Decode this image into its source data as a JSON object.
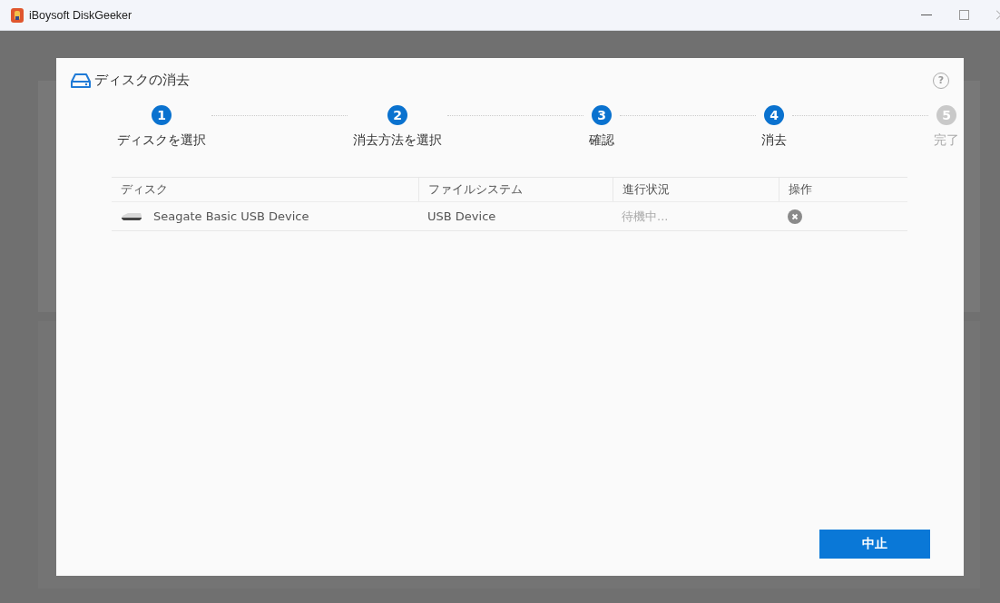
{
  "window": {
    "title": "iBoysoft DiskGeeker"
  },
  "dialog": {
    "title": "ディスクの消去",
    "help": "?",
    "steps": [
      {
        "number": "1",
        "label": "ディスクを選択",
        "reached": true
      },
      {
        "number": "2",
        "label": "消去方法を選択",
        "reached": true
      },
      {
        "number": "3",
        "label": "確認",
        "reached": true
      },
      {
        "number": "4",
        "label": "消去",
        "reached": true
      },
      {
        "number": "5",
        "label": "完了",
        "reached": false
      }
    ],
    "table": {
      "columns": [
        "ディスク",
        "ファイルシステム",
        "進行状況",
        "操作"
      ],
      "rows": [
        {
          "disk": "Seagate Basic USB Device",
          "file_system": "USB Device",
          "progress": "待機中..."
        }
      ]
    },
    "buttons": [
      "中止"
    ]
  }
}
